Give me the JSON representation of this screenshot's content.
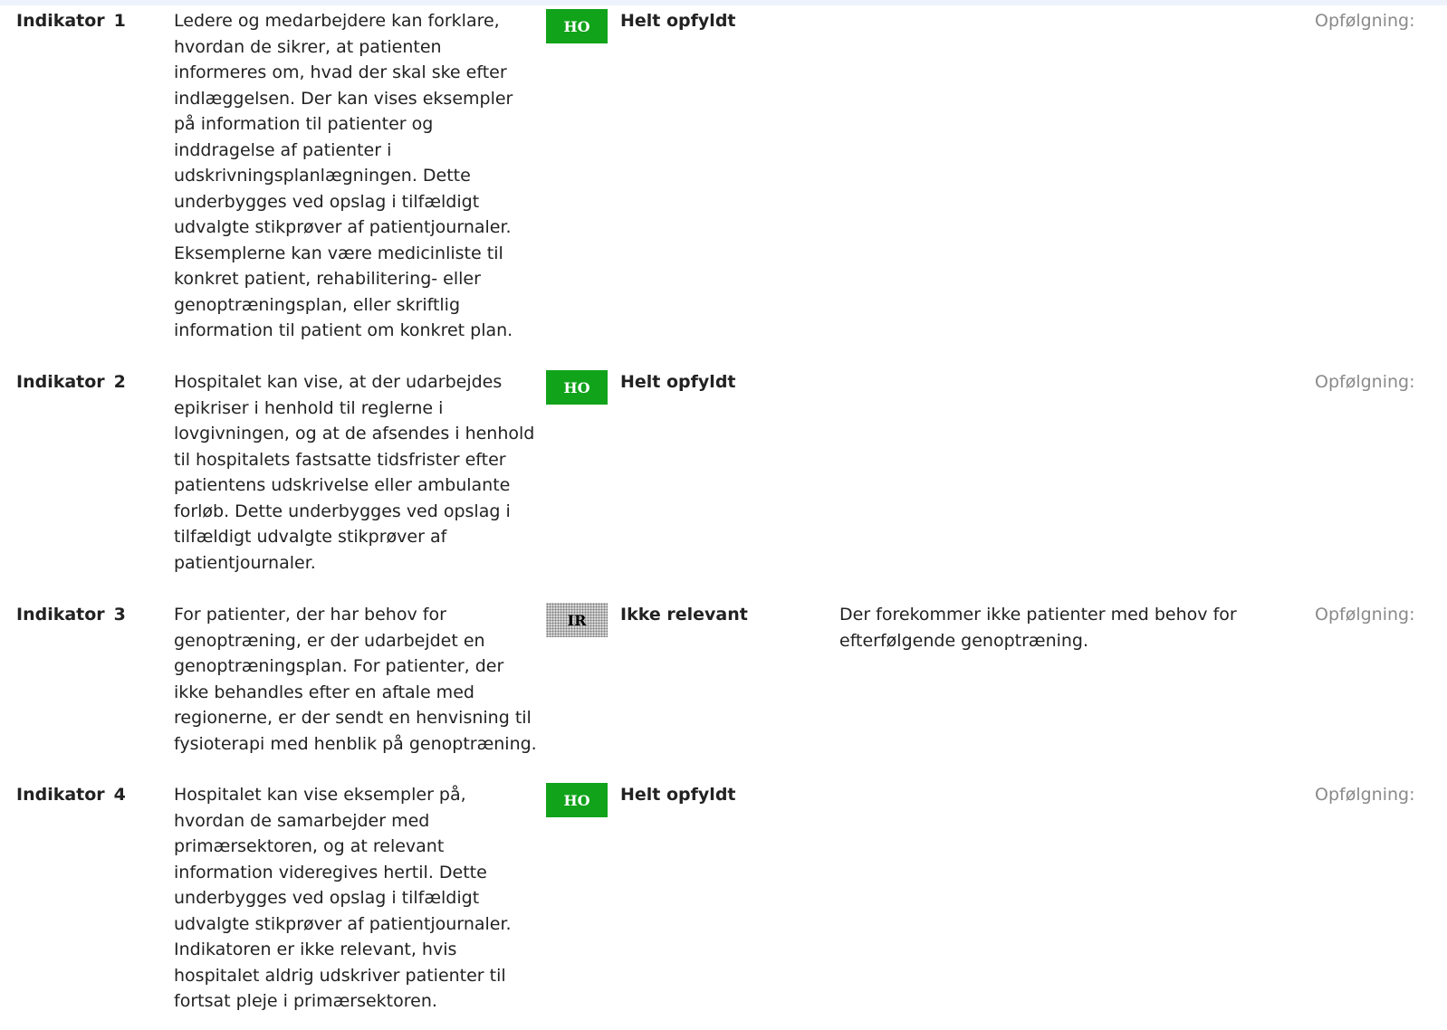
{
  "followup_label": "Opfølgning:",
  "indicators": [
    {
      "label": "Indikator",
      "number": "1",
      "description": "Ledere og medarbejdere kan forklare,\nhvordan de sikrer, at patienten\ninformeres om, hvad der skal ske efter\nindlæggelsen. Der kan vises eksempler\npå information til patienter og\ninddragelse af patienter i\nudskrivningsplanlægningen. Dette\nunderbygges ved opslag i tilfældigt\nudvalgte stikprøver af patientjournaler.\nEksemplerne kan være medicinliste til\nkonkret patient, rehabilitering- eller\ngenoptræningsplan, eller skriftlig\ninformation til patient om konkret plan.",
      "badge": "HO",
      "status": "Helt opfyldt",
      "comment": ""
    },
    {
      "label": "Indikator",
      "number": "2",
      "description": "Hospitalet kan vise, at der udarbejdes\nepikriser i henhold til reglerne i\nlovgivningen, og at de afsendes i henhold\ntil hospitalets fastsatte tidsfrister efter\npatientens udskrivelse eller ambulante\nforløb. Dette underbygges ved opslag i\ntilfældigt udvalgte stikprøver af\npatientjournaler.",
      "badge": "HO",
      "status": "Helt opfyldt",
      "comment": ""
    },
    {
      "label": "Indikator",
      "number": "3",
      "description": "For patienter, der har behov for\ngenoptræning, er der udarbejdet en\ngenoptræningsplan.   For patienter, der\nikke behandles efter en aftale med\nregionerne, er der sendt en henvisning til\nfysioterapi med henblik på genoptræning.",
      "badge": "IR",
      "status": "Ikke relevant",
      "comment": "Der forekommer ikke patienter med behov for\nefterfølgende genoptræning."
    },
    {
      "label": "Indikator",
      "number": "4",
      "description": "Hospitalet kan vise eksempler på,\nhvordan de samarbejder med\nprimærsektoren, og at relevant\ninformation videregives hertil. Dette\nunderbygges ved opslag i tilfældigt\nudvalgte stikprøver af patientjournaler.\nIndikatoren er ikke relevant, hvis\nhospitalet aldrig udskriver patienter til\nfortsat pleje i primærsektoren.",
      "badge": "HO",
      "status": "Helt opfyldt",
      "comment": ""
    }
  ]
}
